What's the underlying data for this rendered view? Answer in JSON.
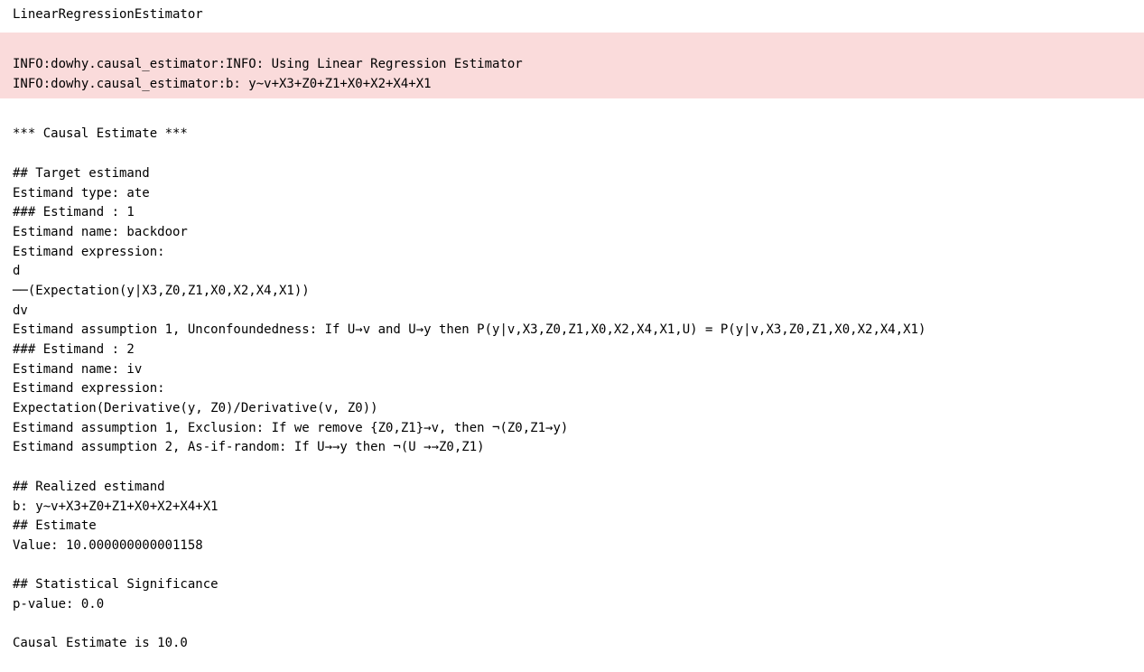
{
  "header": "LinearRegressionEstimator",
  "info": {
    "line1": "INFO:dowhy.causal_estimator:INFO: Using Linear Regression Estimator",
    "line2": "INFO:dowhy.causal_estimator:b: y~v+X3+Z0+Z1+X0+X2+X4+X1"
  },
  "output": {
    "title": "*** Causal Estimate ***",
    "target_header": "## Target estimand",
    "estimand_type": "Estimand type: ate",
    "estimand1_header": "### Estimand : 1",
    "estimand1_name": "Estimand name: backdoor",
    "estimand1_expr_label": "Estimand expression:",
    "estimand1_expr_top": "d",
    "estimand1_expr_mid": "──(Expectation(y|X3,Z0,Z1,X0,X2,X4,X1))",
    "estimand1_expr_bot": "dv",
    "estimand1_assumption": "Estimand assumption 1, Unconfoundedness: If U→v and U→y then P(y|v,X3,Z0,Z1,X0,X2,X4,X1,U) = P(y|v,X3,Z0,Z1,X0,X2,X4,X1)",
    "estimand2_header": "### Estimand : 2",
    "estimand2_name": "Estimand name: iv",
    "estimand2_expr_label": "Estimand expression:",
    "estimand2_expr": "Expectation(Derivative(y, Z0)/Derivative(v, Z0))",
    "estimand2_assumption1": "Estimand assumption 1, Exclusion: If we remove {Z0,Z1}→v, then ¬(Z0,Z1→y)",
    "estimand2_assumption2": "Estimand assumption 2, As-if-random: If U→→y then ¬(U →→Z0,Z1)",
    "realized_header": "## Realized estimand",
    "realized_expr": "b: y~v+X3+Z0+Z1+X0+X2+X4+X1",
    "estimate_header": "## Estimate",
    "estimate_value": "Value: 10.000000000001158",
    "stat_header": "## Statistical Significance",
    "pvalue": "p-value: 0.0",
    "final": "Causal Estimate is 10.0"
  }
}
